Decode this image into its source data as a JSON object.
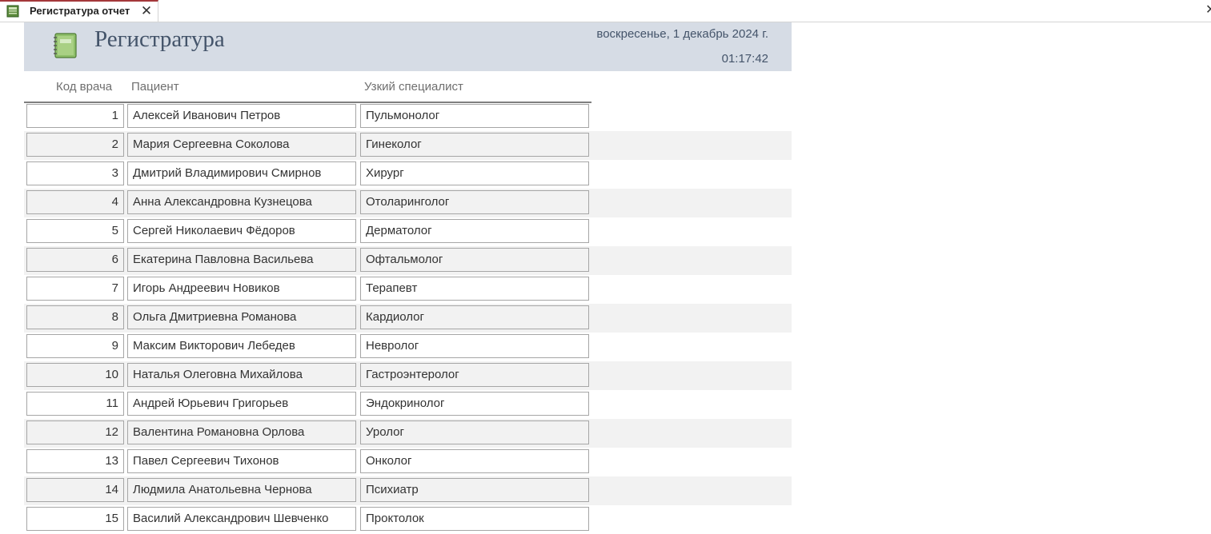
{
  "tab": {
    "title": "Регистратура отчет",
    "icon": "report-icon",
    "close_glyph": "✕"
  },
  "window": {
    "close_glyph": "✕"
  },
  "report": {
    "title": "Регистратура",
    "icon": "notebook-icon",
    "date": "воскресенье, 1 декабрь 2024 г.",
    "time": "01:17:42",
    "columns": {
      "code": "Код врача",
      "patient": "Пациент",
      "specialist": "Узкий специалист"
    },
    "rows": [
      {
        "code": "1",
        "patient": "Алексей Иванович Петров",
        "specialist": "Пульмонолог"
      },
      {
        "code": "2",
        "patient": "Мария Сергеевна Соколова",
        "specialist": "Гинеколог"
      },
      {
        "code": "3",
        "patient": "Дмитрий Владимирович Смирнов",
        "specialist": "Хирург"
      },
      {
        "code": "4",
        "patient": "Анна Александровна Кузнецова",
        "specialist": "Отоларинголог"
      },
      {
        "code": "5",
        "patient": "Сергей Николаевич Фёдоров",
        "specialist": "Дерматолог"
      },
      {
        "code": "6",
        "patient": "Екатерина Павловна Васильева",
        "specialist": "Офтальмолог"
      },
      {
        "code": "7",
        "patient": "Игорь Андреевич Новиков",
        "specialist": "Терапевт"
      },
      {
        "code": "8",
        "patient": "Ольга Дмитриевна Романова",
        "specialist": "Кардиолог"
      },
      {
        "code": "9",
        "patient": "Максим Викторович Лебедев",
        "specialist": "Невролог"
      },
      {
        "code": "10",
        "patient": "Наталья Олеговна Михайлова",
        "specialist": "Гастроэнтеролог"
      },
      {
        "code": "11",
        "patient": "Андрей Юрьевич Григорьев",
        "specialist": "Эндокринолог"
      },
      {
        "code": "12",
        "patient": "Валентина Романовна Орлова",
        "specialist": "Уролог"
      },
      {
        "code": "13",
        "patient": "Павел Сергеевич Тихонов",
        "specialist": "Онколог"
      },
      {
        "code": "14",
        "patient": "Людмила Анатольевна Чернова",
        "specialist": "Психиатр"
      },
      {
        "code": "15",
        "patient": "Василий Александрович Шевченко",
        "specialist": "Проктолок"
      }
    ]
  }
}
